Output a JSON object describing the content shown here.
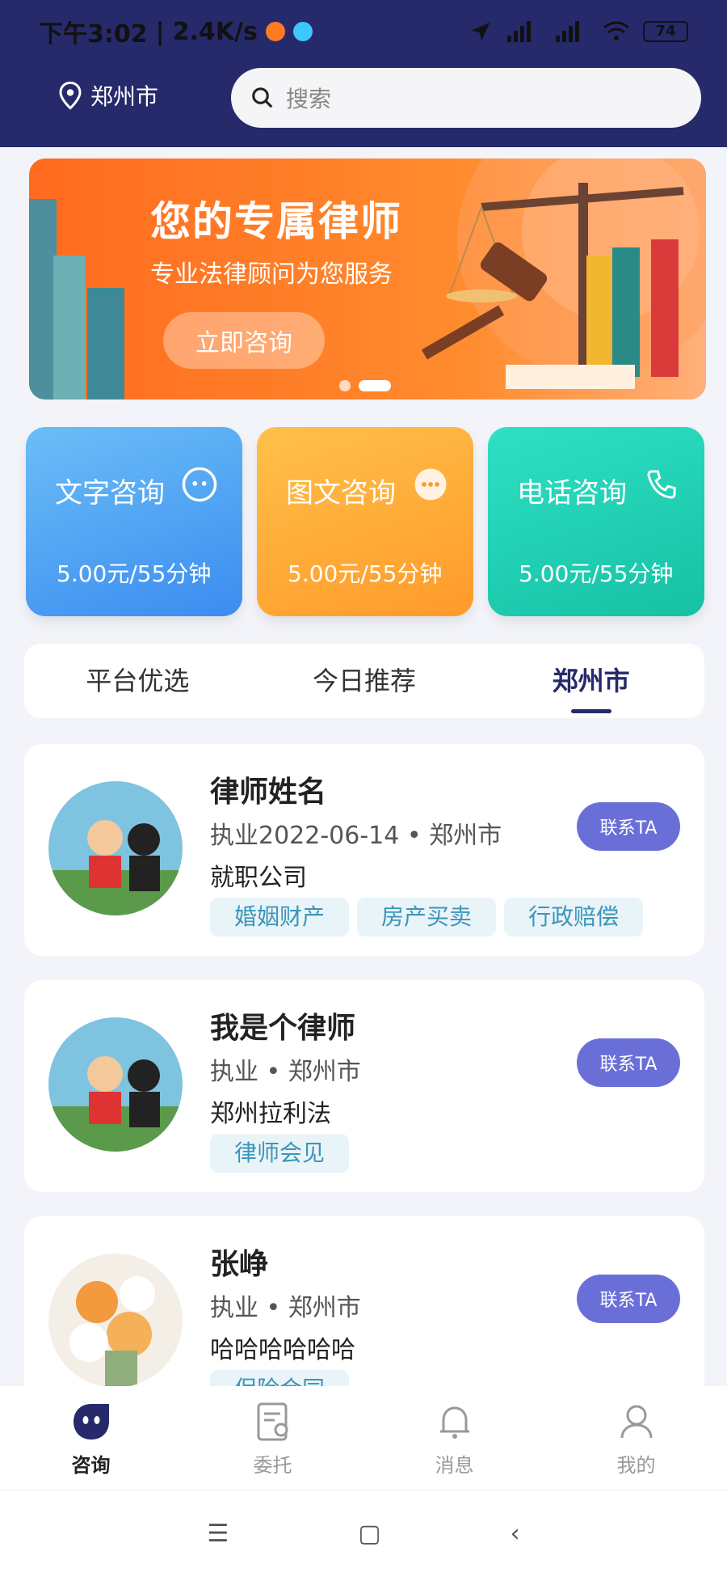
{
  "status_bar": {
    "time": "下午3:02",
    "speed": "2.4K/s",
    "battery": "74"
  },
  "header": {
    "location": "郑州市",
    "search_placeholder": "搜索"
  },
  "banner": {
    "title": "您的专属律师",
    "subtitle": "专业法律顾问为您服务",
    "button": "立即咨询"
  },
  "consult_cards": [
    {
      "title": "文字咨询",
      "price": "5.00元/55分钟",
      "icon": "chat-icon"
    },
    {
      "title": "图文咨询",
      "price": "5.00元/55分钟",
      "icon": "message-icon"
    },
    {
      "title": "电话咨询",
      "price": "5.00元/55分钟",
      "icon": "phone-icon"
    }
  ],
  "tabs": [
    "平台优选",
    "今日推荐",
    "郑州市"
  ],
  "lawyers": [
    {
      "name": "律师姓名",
      "meta": "执业2022-06-14 • 郑州市",
      "company": "就职公司",
      "tags": [
        "婚姻财产",
        "房产买卖",
        "行政赔偿"
      ],
      "contact": "联系TA"
    },
    {
      "name": "我是个律师",
      "meta": "执业 • 郑州市",
      "company": "郑州拉利法",
      "tags": [
        "律师会见"
      ],
      "contact": "联系TA"
    },
    {
      "name": "张峥",
      "meta": "执业 • 郑州市",
      "company": "哈哈哈哈哈哈",
      "tags": [
        "保险合同"
      ],
      "contact": "联系TA"
    }
  ],
  "bottom_nav": [
    "咨询",
    "委托",
    "消息",
    "我的"
  ],
  "colors": {
    "header": "#262a6b",
    "accent": "#6a6fd8",
    "banner": "#ff7a22"
  }
}
